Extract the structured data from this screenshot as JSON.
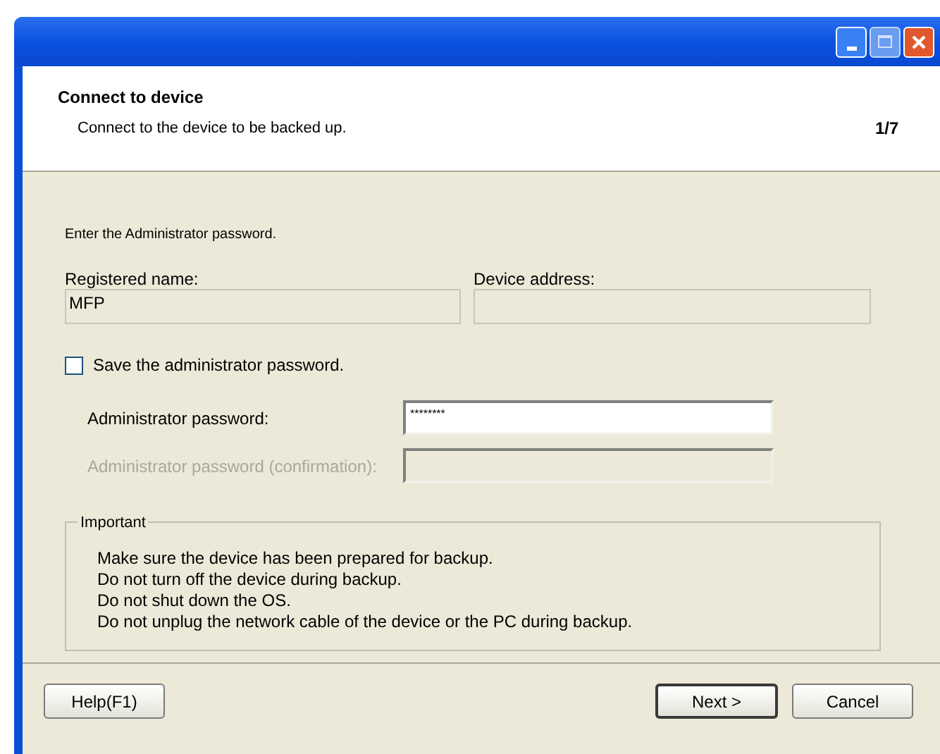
{
  "header": {
    "title": "Connect to device",
    "subtitle": "Connect to the device to be backed up.",
    "step": "1/7"
  },
  "instruction": "Enter the Administrator password.",
  "registered_name": {
    "label": "Registered name:",
    "value": "MFP",
    "disabled": true
  },
  "device_address": {
    "label": "Device address:",
    "disabled": true
  },
  "save_password": {
    "label": "Save the administrator password.",
    "checked": false
  },
  "password": {
    "label": "Administrator password:",
    "value": "********",
    "disabled": false
  },
  "password_confirmation": {
    "label": "Administrator password (confirmation):",
    "disabled": true
  },
  "important": {
    "legend": "Important",
    "lines": [
      "Make sure the device has been prepared for backup.",
      "Do not turn off the device during backup.",
      "Do not shut down the OS.",
      "Do not unplug the network cable of the device or the PC during backup."
    ]
  },
  "buttons": {
    "help": "Help(F1)",
    "next": "Next >",
    "cancel": "Cancel"
  }
}
